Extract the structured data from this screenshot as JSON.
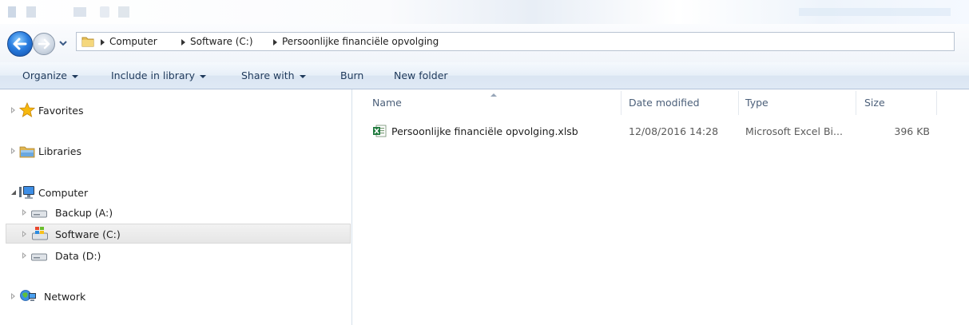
{
  "address": {
    "crumbs": [
      "Computer",
      "Software (C:)",
      "Persoonlijke financiële opvolging"
    ]
  },
  "toolbar": {
    "organize": "Organize",
    "include_in_library": "Include in library",
    "share_with": "Share with",
    "burn": "Burn",
    "new_folder": "New folder"
  },
  "nav": {
    "favorites": "Favorites",
    "libraries": "Libraries",
    "computer": "Computer",
    "backup": "Backup (A:)",
    "software": "Software (C:)",
    "data": "Data (D:)",
    "network": "Network"
  },
  "columns": {
    "name": "Name",
    "date_modified": "Date modified",
    "type": "Type",
    "size": "Size"
  },
  "files": [
    {
      "name": "Persoonlijke financiële opvolging.xlsb",
      "date_modified": "12/08/2016 14:28",
      "type": "Microsoft Excel Bi...",
      "size": "396 KB",
      "icon": "excel-file-icon"
    }
  ],
  "colors": {
    "command_text": "#1e395b",
    "header_text": "#4c607a",
    "accent_blue": "#2a7ee0"
  }
}
